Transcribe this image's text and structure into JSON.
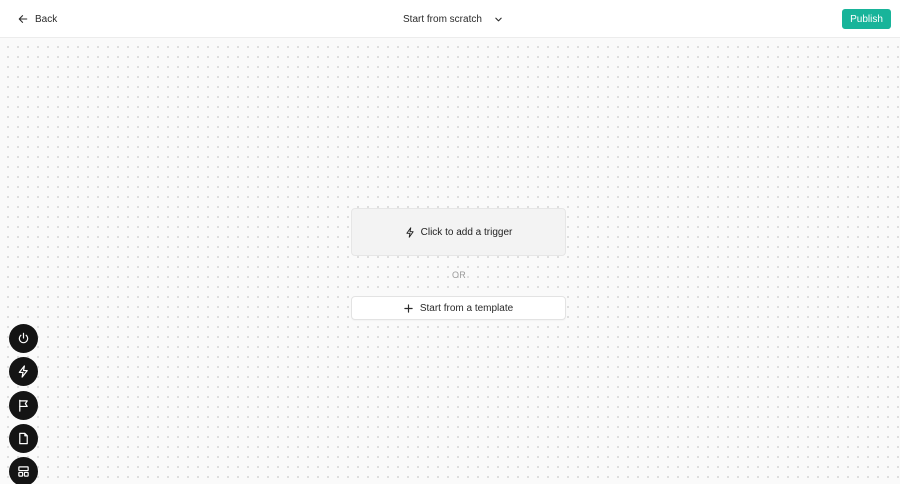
{
  "header": {
    "back_label": "Back",
    "title": "Start from scratch",
    "publish_label": "Publish"
  },
  "canvas": {
    "trigger_label": "Click to add a trigger",
    "or_label": "OR",
    "template_label": "Start from a template"
  },
  "toolbox": {
    "items": [
      {
        "icon": "power-icon"
      },
      {
        "icon": "lightning-icon"
      },
      {
        "icon": "flag-icon"
      },
      {
        "icon": "document-icon"
      },
      {
        "icon": "layout-icon"
      }
    ]
  },
  "colors": {
    "accent": "#18b49a",
    "tool_bg": "#141414",
    "canvas_bg": "#fafafa"
  }
}
